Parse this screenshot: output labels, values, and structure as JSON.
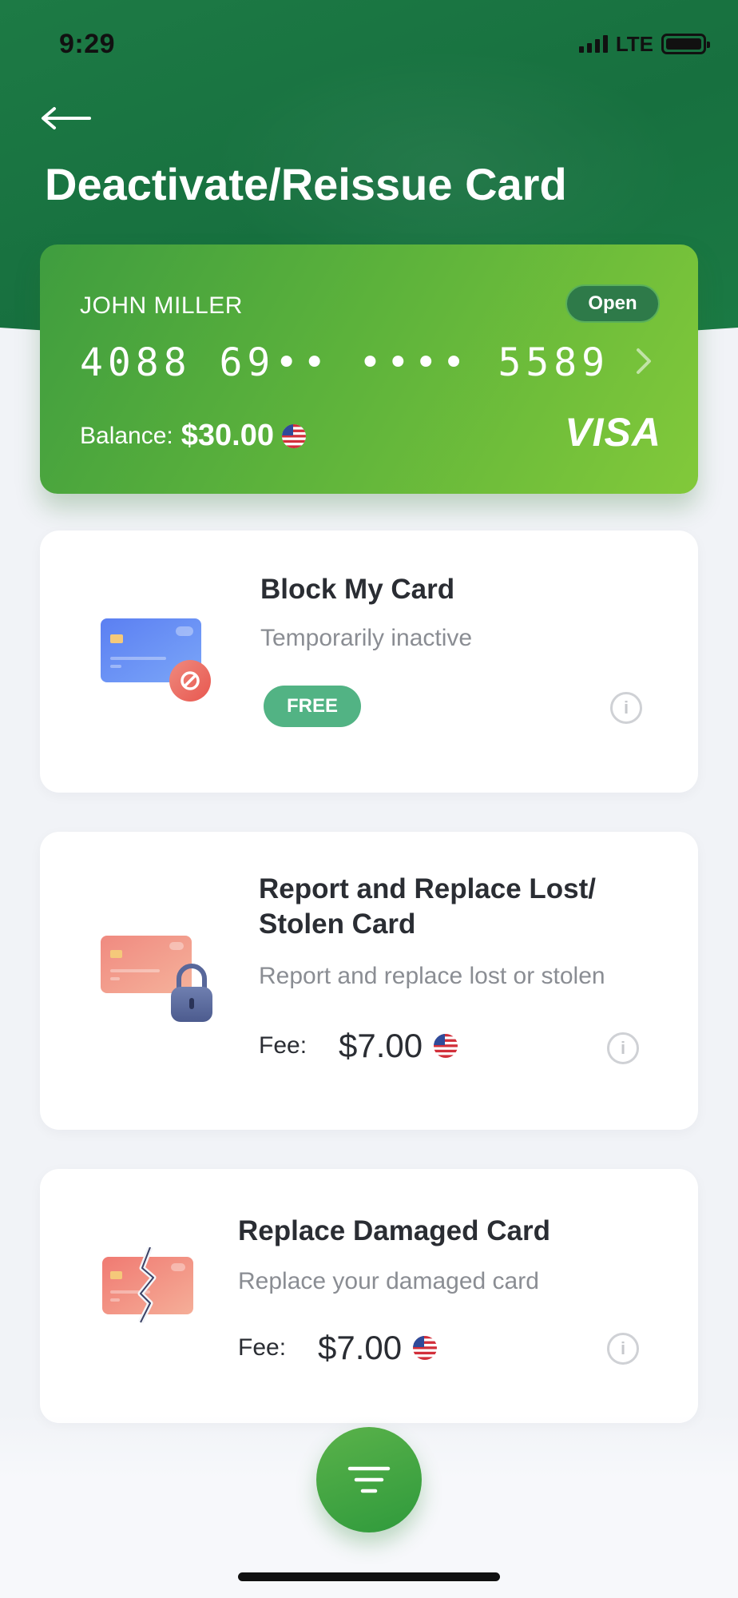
{
  "status_bar": {
    "time": "9:29",
    "network": "LTE"
  },
  "header": {
    "title": "Deactivate/Reissue Card"
  },
  "card": {
    "holder": "JOHN MILLER",
    "status": "Open",
    "number": "4088 69•• ••••  5589",
    "balance_label": "Balance:",
    "balance_value": "$30.00",
    "brand": "VISA"
  },
  "options": [
    {
      "title": "Block My Card",
      "subtitle": "Temporarily inactive",
      "badge": "FREE"
    },
    {
      "title": "Report and Replace Lost/ Stolen Card",
      "subtitle": "Report and replace lost or stolen",
      "fee_label": "Fee:",
      "fee_value": "$7.00"
    },
    {
      "title": "Replace Damaged Card",
      "subtitle": "Replace your damaged card",
      "fee_label": "Fee:",
      "fee_value": "$7.00"
    }
  ],
  "colors": {
    "header": "#1b7a44",
    "card_start": "#3f9d3f",
    "card_end": "#82c93a",
    "badge_free": "#52b384",
    "fab": "#3fa342"
  },
  "icons": [
    "back-arrow-icon",
    "chevron-right-icon",
    "us-flag-icon",
    "block-card-icon",
    "lock-card-icon",
    "damaged-card-icon",
    "info-icon",
    "filter-icon"
  ]
}
